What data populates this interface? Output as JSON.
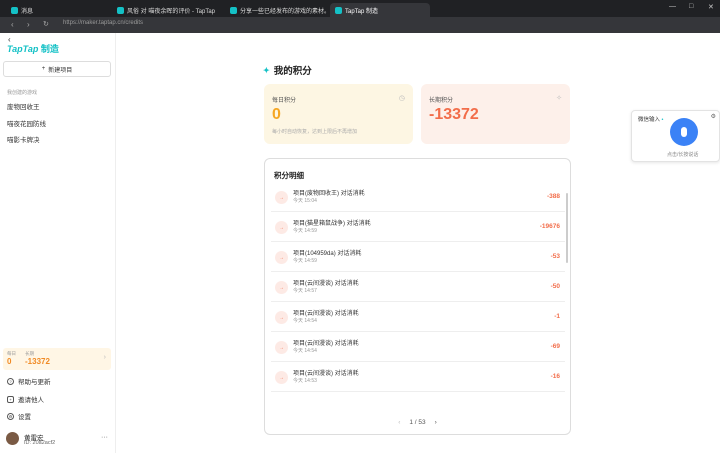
{
  "browser": {
    "tabs": [
      {
        "label": "消息",
        "active": false
      },
      {
        "label": "风俗 对 喵夜余晖的评价 - TapTap",
        "active": false
      },
      {
        "label": "分享一些已经发布的游戏的素材。还...",
        "active": false
      },
      {
        "label": "TapTap 制造",
        "active": true
      }
    ],
    "url": "https://maker.taptap.cn/credits"
  },
  "sidebar": {
    "logo": "TapTap",
    "logo_suffix": "制造",
    "new_project": "新建项目",
    "section": "我创建的游戏",
    "items": [
      "废物回收王",
      "喵夜花园防线",
      "喵影卡牌决"
    ],
    "credits": {
      "daily_label": "每日",
      "daily_value": "0",
      "long_label": "长期",
      "long_value": "-13372"
    },
    "menu": [
      {
        "label": "帮助与更新",
        "icon": "help-icon"
      },
      {
        "label": "邀请他人",
        "icon": "invite-icon"
      },
      {
        "label": "设置",
        "icon": "gear-icon"
      }
    ],
    "user": {
      "name": "黄雷宏",
      "id": "ID: 20a2acf2"
    }
  },
  "main": {
    "title": "我的积分",
    "daily": {
      "label": "每日积分",
      "value": "0",
      "desc": "每小时自动恢复，达到上限后不再增加"
    },
    "long": {
      "label": "长期积分",
      "value": "-13372"
    },
    "detail_title": "积分明细",
    "rows": [
      {
        "title": "项目(废物回收王) 对话消耗",
        "time": "今天 15:04",
        "amount": "-388"
      },
      {
        "title": "项目(猫星箱鼠战争) 对话消耗",
        "time": "今天 14:59",
        "amount": "-19676"
      },
      {
        "title": "项目(104959da) 对话消耗",
        "time": "今天 14:59",
        "amount": "-53"
      },
      {
        "title": "项目(云间漫谈) 对话消耗",
        "time": "今天 14:57",
        "amount": "-50"
      },
      {
        "title": "项目(云间漫谈) 对话消耗",
        "time": "今天 14:54",
        "amount": "-1"
      },
      {
        "title": "项目(云间漫谈) 对话消耗",
        "time": "今天 14:54",
        "amount": "-69"
      },
      {
        "title": "项目(云间漫谈) 对话消耗",
        "time": "今天 14:53",
        "amount": "-16"
      }
    ],
    "pager": "1 / 53"
  },
  "voice": {
    "title": "微信输入",
    "hint": "点击/长按说话"
  },
  "colors": {
    "accent": "#14c1c6",
    "daily": "#f5a623",
    "negative": "#f26d4a"
  }
}
